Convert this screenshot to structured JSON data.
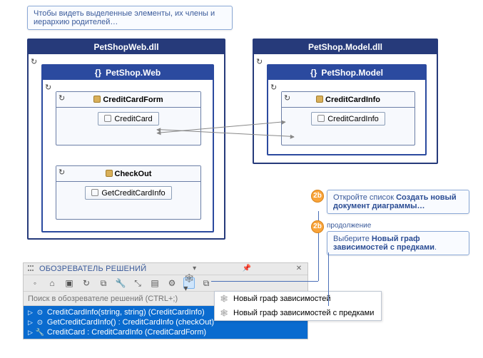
{
  "callouts": {
    "top": "Чтобы видеть выделенные элементы, их члены и иерархию родителей…",
    "c1_a": "Откройте список ",
    "c1_b": "Создать новый документ диаграммы…",
    "c2_label": "продолжение",
    "c2_a": "Выберите ",
    "c2_b": "Новый граф зависимостей с предками",
    "c2_c": ".",
    "bubble": "2b"
  },
  "packages": {
    "left": {
      "title": "PetShopWeb.dll",
      "ns": "PetShop.Web",
      "classes": [
        {
          "name": "CreditCardForm",
          "member": "CreditCard"
        },
        {
          "name": "CheckOut",
          "member": "GetCreditCardInfo"
        }
      ]
    },
    "right": {
      "title": "PetShop.Model.dll",
      "ns": "PetShop.Model",
      "classes": [
        {
          "name": "CreditCardInfo",
          "member": "CreditCardInfo"
        }
      ]
    }
  },
  "solution": {
    "title": "ОБОЗРЕВАТЕЛЬ РЕШЕНИЙ",
    "searchPlaceholder": "Поиск в обозревателе решений (CTRL+;)",
    "menu": [
      "Новый граф зависимостей",
      "Новый граф зависимостей с предками"
    ],
    "tree": [
      "CreditCardInfo(string, string) (CreditCardInfo)",
      "GetCreditCardInfo() : CreditCardInfo (checkOut)",
      "CreditCard : CreditCardInfo (CreditCardForm)"
    ]
  }
}
